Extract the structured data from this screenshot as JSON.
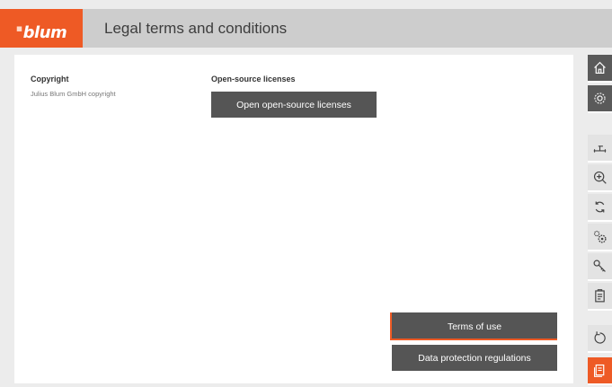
{
  "header": {
    "brand": "blum",
    "title": "Legal terms and conditions"
  },
  "copyright": {
    "title": "Copyright",
    "text": "Julius Blum GmbH copyright"
  },
  "open_source": {
    "title": "Open-source licenses",
    "button_label": "Open open-source licenses"
  },
  "actions": {
    "terms_label": "Terms of use",
    "data_protection_label": "Data protection regulations"
  },
  "sidebar": {
    "items": [
      {
        "icon": "home-icon"
      },
      {
        "icon": "settings-icon"
      },
      {
        "icon": "measure-icon"
      },
      {
        "icon": "zoom-icon"
      },
      {
        "icon": "sync-icon"
      },
      {
        "icon": "gears-icon"
      },
      {
        "icon": "key-icon"
      },
      {
        "icon": "clipboard-icon"
      },
      {
        "icon": "reset-icon"
      },
      {
        "icon": "legal-document-icon"
      }
    ]
  },
  "colors": {
    "brand": "#ee5a25",
    "button": "#555555",
    "header_bg": "#cdcdcd"
  }
}
